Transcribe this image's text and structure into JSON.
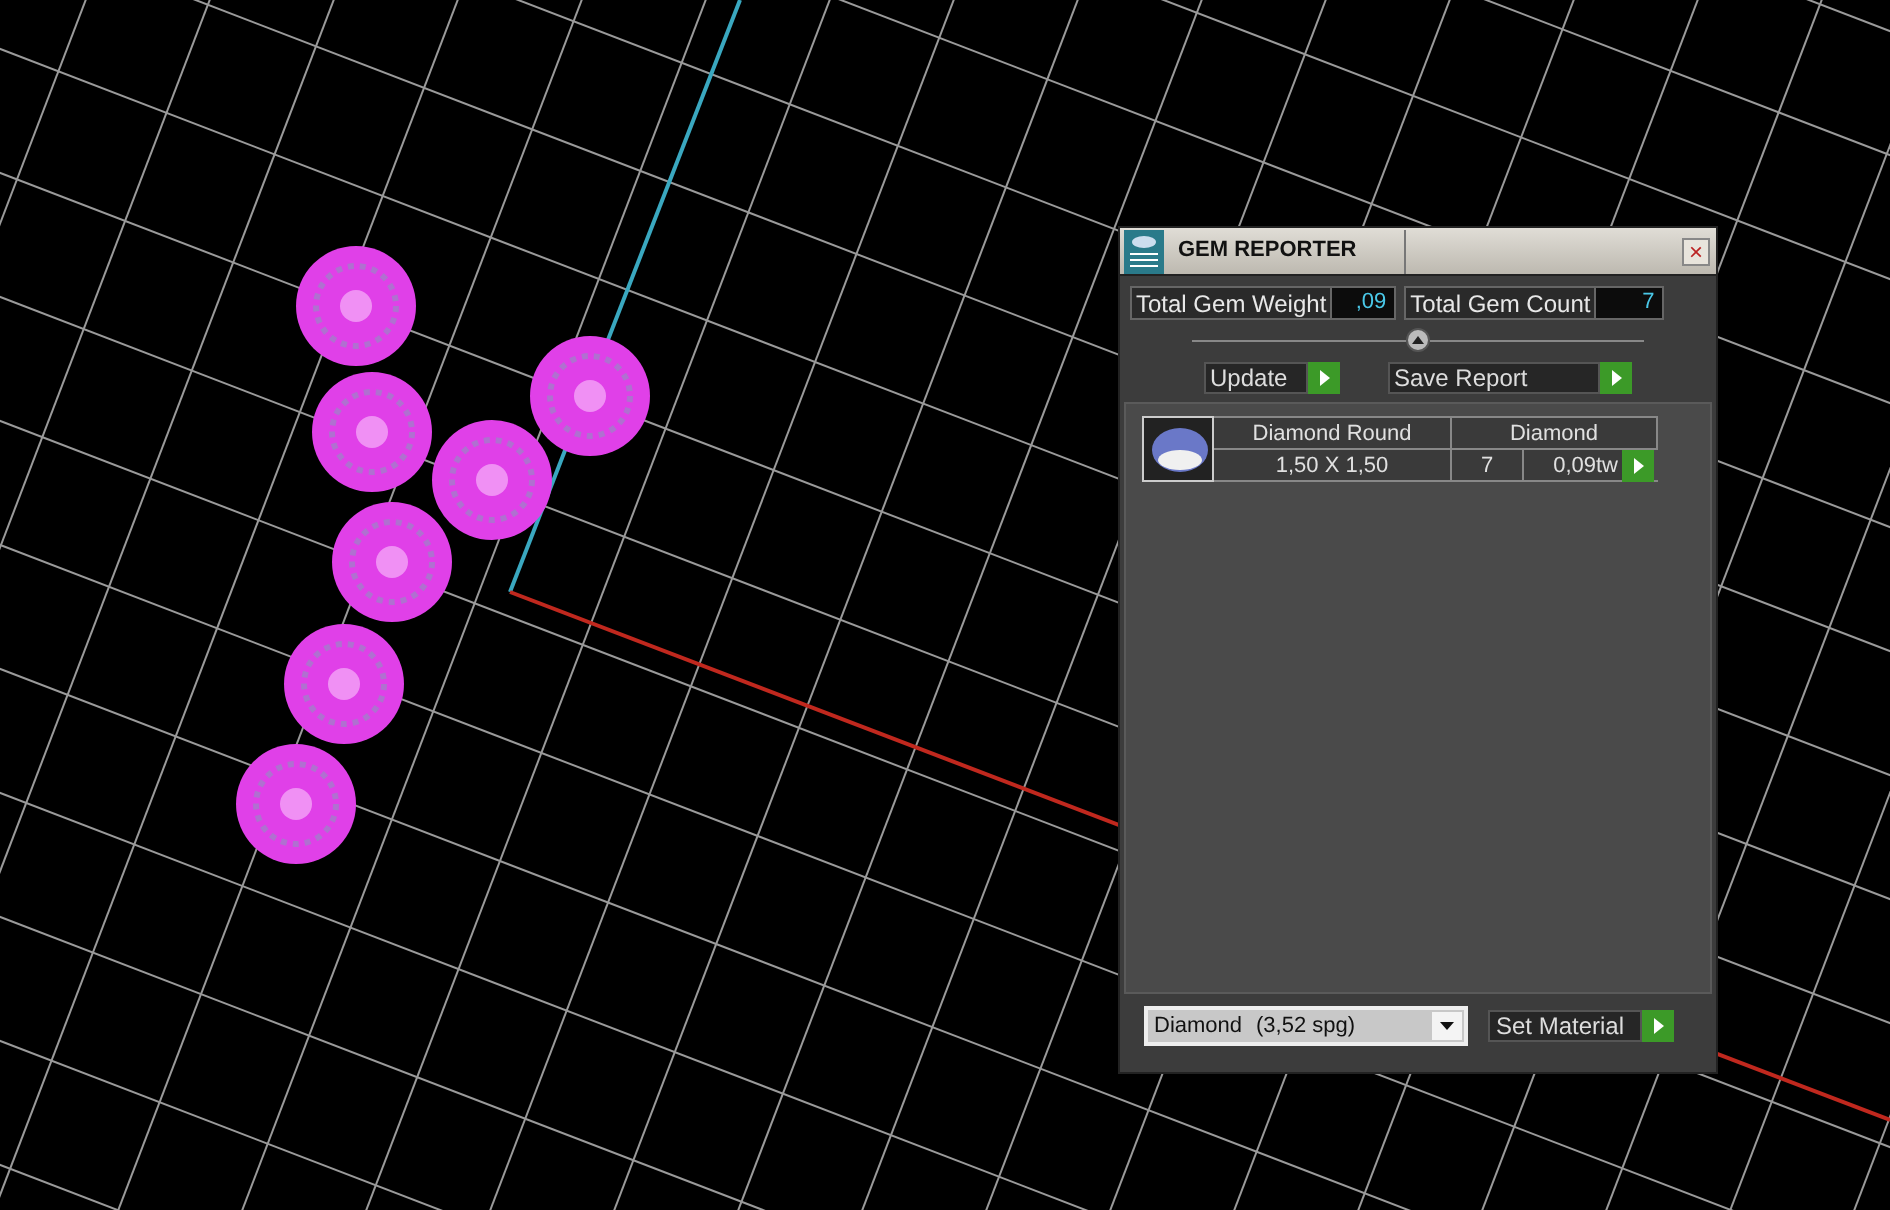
{
  "window": {
    "title": "GEM REPORTER",
    "close": "×"
  },
  "totals": [
    {
      "label": "Total Gem Weight",
      "value": ",09"
    },
    {
      "label": "Total Gem Count",
      "value": "7"
    }
  ],
  "collapse": {
    "expanded": true
  },
  "actions": [
    {
      "label": "Update"
    },
    {
      "label": "Save Report"
    }
  ],
  "gems": [
    {
      "name": "Diamond Round",
      "material": "Diamond",
      "size": "1,50 X 1,50",
      "count": "7",
      "weight": "0,09tw"
    }
  ],
  "material_select": {
    "name": "Diamond",
    "density": "(3,52 spg)"
  },
  "set_material": {
    "label": "Set Material"
  }
}
